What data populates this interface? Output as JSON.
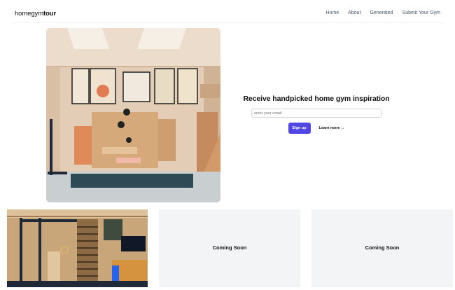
{
  "brand": {
    "name_regular": "homegym",
    "name_bold": "tour"
  },
  "nav": {
    "links": [
      "Home",
      "About",
      "Generated",
      "Submit Your Gym"
    ]
  },
  "newsletter": {
    "heading": "Receive handpicked home gym inspiration",
    "email_placeholder": "enter your email",
    "signup_label": "Sign up",
    "learn_more_label": "Learn more →"
  },
  "cards": [
    {
      "label": ""
    },
    {
      "label": "Coming Soon"
    },
    {
      "label": "Coming Soon"
    }
  ],
  "colors": {
    "accent": "#4f46e5",
    "placeholder_card": "#f3f4f6"
  }
}
